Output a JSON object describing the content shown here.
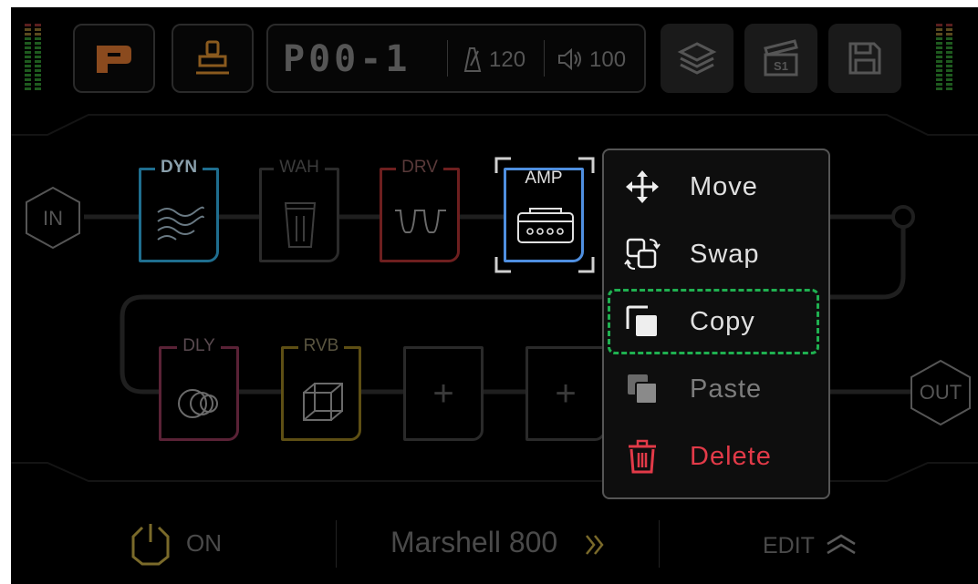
{
  "topbar": {
    "preset_name": "P00-1",
    "tempo": "120",
    "volume": "100"
  },
  "chain": {
    "input_label": "IN",
    "output_label": "OUT",
    "row1": [
      {
        "label": "DYN",
        "color": "#1f6e8f",
        "icon": "wave-icon"
      },
      {
        "label": "WAH",
        "color": "#2b2b2b",
        "icon": "wah-pedal-icon"
      },
      {
        "label": "DRV",
        "color": "#6e1f1f",
        "icon": "square-wave-icon"
      },
      {
        "label": "AMP",
        "color": "#4f8fe0",
        "icon": "amp-head-icon",
        "selected": true
      }
    ],
    "row2": [
      {
        "label": "DLY",
        "color": "#5a2236",
        "icon": "delay-circles-icon"
      },
      {
        "label": "RVB",
        "color": "#5e4f14",
        "icon": "cube-icon"
      },
      {
        "label": "+",
        "icon": "plus-icon"
      },
      {
        "label": "+",
        "icon": "plus-icon"
      }
    ]
  },
  "context_menu": {
    "items": [
      {
        "label": "Move",
        "icon": "move-arrows-icon"
      },
      {
        "label": "Swap",
        "icon": "swap-icon"
      },
      {
        "label": "Copy",
        "icon": "copy-icon",
        "focused": true
      },
      {
        "label": "Paste",
        "icon": "paste-icon",
        "disabled": true
      },
      {
        "label": "Delete",
        "icon": "trash-icon",
        "danger": true
      }
    ],
    "focus_color": "#1fb050",
    "danger_color": "#e23a48"
  },
  "bottom": {
    "power_label": "ON",
    "amp_model": "Marshell 800",
    "edit_label": "EDIT"
  },
  "colors": {
    "background": "#000000",
    "accent_blue": "#4f8fe0",
    "logo_orange": "#8a4a1e"
  }
}
